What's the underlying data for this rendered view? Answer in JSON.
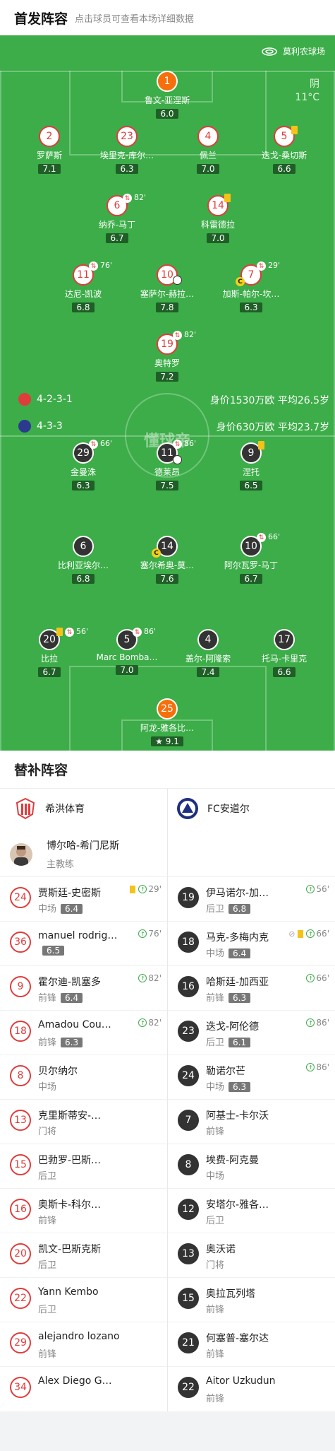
{
  "header": {
    "title": "首发阵容",
    "subtitle": "点击球员可查看本场详细数据"
  },
  "pitch": {
    "stadium": "莫利农球场",
    "weather": "阴",
    "temperature": "11°C",
    "watermark": "懂球帝",
    "home_formation": "4-2-3-1",
    "away_formation": "4-3-3",
    "home_value": "身价1530万欧  平均26.5岁",
    "away_value": "身价630万欧  平均23.7岁",
    "home_players": [
      {
        "num": "1",
        "name": "鲁文-亚涅斯",
        "rating": "6.0"
      },
      {
        "num": "2",
        "name": "罗萨斯",
        "rating": "7.1"
      },
      {
        "num": "23",
        "name": "埃里克-库尔…",
        "rating": "6.3"
      },
      {
        "num": "4",
        "name": "佩兰",
        "rating": "7.0"
      },
      {
        "num": "5",
        "name": "迭戈-桑切斯",
        "rating": "6.6"
      },
      {
        "num": "6",
        "name": "纳乔-马丁",
        "rating": "6.7",
        "sub": "82'"
      },
      {
        "num": "14",
        "name": "科雷德拉",
        "rating": "7.0"
      },
      {
        "num": "11",
        "name": "达尼-凯波",
        "rating": "6.8",
        "sub": "76'"
      },
      {
        "num": "10",
        "name": "塞萨尔-赫拉…",
        "rating": "7.8"
      },
      {
        "num": "7",
        "name": "加斯-帕尔-坎…",
        "rating": "6.3",
        "sub": "29'"
      },
      {
        "num": "19",
        "name": "奥特罗",
        "rating": "7.2",
        "sub": "82'"
      }
    ],
    "away_players": [
      {
        "num": "29",
        "name": "金曼洙",
        "rating": "6.3",
        "sub": "66'"
      },
      {
        "num": "11",
        "name": "德莱昂",
        "rating": "7.5",
        "sub": "86'"
      },
      {
        "num": "9",
        "name": "涅托",
        "rating": "6.5"
      },
      {
        "num": "6",
        "name": "比利亚埃尔…",
        "rating": "6.8"
      },
      {
        "num": "14",
        "name": "塞尔希奥-莫…",
        "rating": "7.6"
      },
      {
        "num": "10",
        "name": "阿尔瓦罗-马丁",
        "rating": "6.7",
        "sub": "66'"
      },
      {
        "num": "20",
        "name": "比拉",
        "rating": "6.7",
        "sub": "56'"
      },
      {
        "num": "5",
        "name": "Marc Bomba…",
        "rating": "7.0",
        "sub": "86'"
      },
      {
        "num": "4",
        "name": "盖尔-阿隆索",
        "rating": "7.4"
      },
      {
        "num": "17",
        "name": "托马-卡里克",
        "rating": "6.6"
      },
      {
        "num": "25",
        "name": "阿龙-雅各比…",
        "rating": "9.1"
      }
    ]
  },
  "subs": {
    "title": "替补阵容",
    "home_team": "希洪体育",
    "away_team": "FC安道尔",
    "coach_name": "博尔哈-希门尼斯",
    "coach_role": "主教练",
    "home": [
      {
        "num": "24",
        "name": "贾斯廷-史密斯",
        "pos": "中场",
        "rating": "6.4",
        "ev": "29'"
      },
      {
        "num": "36",
        "name": "manuel rodrig…",
        "pos": "",
        "rating": "6.5",
        "ev": "76'"
      },
      {
        "num": "9",
        "name": "霍尔迪-凯塞多",
        "pos": "前锋",
        "rating": "6.4",
        "ev": "82'"
      },
      {
        "num": "18",
        "name": "Amadou Cou…",
        "pos": "前锋",
        "rating": "6.3",
        "ev": "82'"
      },
      {
        "num": "8",
        "name": "贝尔纳尔",
        "pos": "中场",
        "rating": "",
        "ev": ""
      },
      {
        "num": "13",
        "name": "克里斯蒂安-…",
        "pos": "门将",
        "rating": "",
        "ev": ""
      },
      {
        "num": "15",
        "name": "巴勃罗-巴斯…",
        "pos": "后卫",
        "rating": "",
        "ev": ""
      },
      {
        "num": "16",
        "name": "奥斯卡-科尔…",
        "pos": "前锋",
        "rating": "",
        "ev": ""
      },
      {
        "num": "20",
        "name": "凯文-巴斯克斯",
        "pos": "后卫",
        "rating": "",
        "ev": ""
      },
      {
        "num": "22",
        "name": "Yann Kembo",
        "pos": "后卫",
        "rating": "",
        "ev": ""
      },
      {
        "num": "29",
        "name": "alejandro lozano",
        "pos": "前锋",
        "rating": "",
        "ev": ""
      },
      {
        "num": "34",
        "name": "Alex Diego G…",
        "pos": "",
        "rating": "",
        "ev": ""
      }
    ],
    "away": [
      {
        "num": "19",
        "name": "伊马诺尔-加…",
        "pos": "后卫",
        "rating": "6.8",
        "ev": "56'"
      },
      {
        "num": "18",
        "name": "马克-多梅内克",
        "pos": "中场",
        "rating": "6.4",
        "ev": "66'"
      },
      {
        "num": "16",
        "name": "哈斯廷-加西亚",
        "pos": "前锋",
        "rating": "6.3",
        "ev": "66'"
      },
      {
        "num": "23",
        "name": "迭戈-阿伦德",
        "pos": "后卫",
        "rating": "6.1",
        "ev": "86'"
      },
      {
        "num": "24",
        "name": "勒诺尔芒",
        "pos": "中场",
        "rating": "6.3",
        "ev": "86'"
      },
      {
        "num": "7",
        "name": "阿基士-卡尔沃",
        "pos": "前锋",
        "rating": "",
        "ev": ""
      },
      {
        "num": "8",
        "name": "埃费-阿克曼",
        "pos": "中场",
        "rating": "",
        "ev": ""
      },
      {
        "num": "12",
        "name": "安塔尔-雅各…",
        "pos": "后卫",
        "rating": "",
        "ev": ""
      },
      {
        "num": "13",
        "name": "奥沃诺",
        "pos": "门将",
        "rating": "",
        "ev": ""
      },
      {
        "num": "15",
        "name": "奥拉瓦列塔",
        "pos": "前锋",
        "rating": "",
        "ev": ""
      },
      {
        "num": "21",
        "name": "何塞普-塞尔达",
        "pos": "前锋",
        "rating": "",
        "ev": ""
      },
      {
        "num": "22",
        "name": "Aitor Uzkudun",
        "pos": "前锋",
        "rating": "",
        "ev": ""
      }
    ]
  }
}
